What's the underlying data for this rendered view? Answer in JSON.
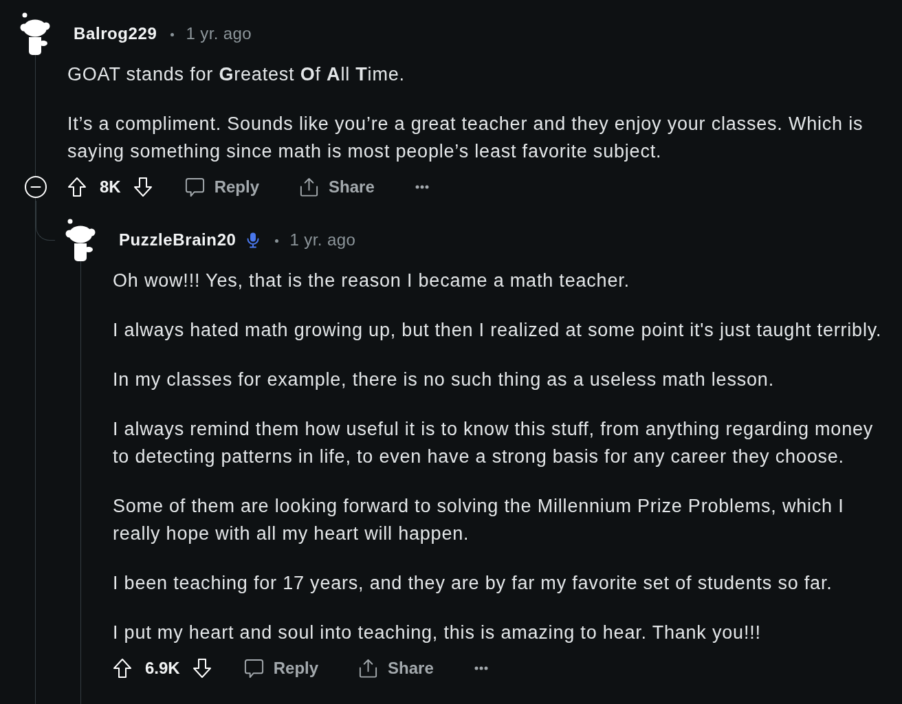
{
  "comments": [
    {
      "author": "Balrog229",
      "time": "1 yr. ago",
      "body": [
        "GOAT stands for **G**reatest **O**f **A**ll **T**ime.",
        "It’s a compliment. Sounds like you’re a great teacher and they enjoy your classes. Which is saying something since math is most people’s least favorite subject."
      ],
      "expanded": true,
      "votes": "8K",
      "reply_label": "Reply",
      "share_label": "Share",
      "replies": [
        {
          "author": "PuzzleBrain20",
          "mic_badge": true,
          "time": "1 yr. ago",
          "body": [
            "Oh wow!!! Yes, that is the reason I became a math teacher.",
            "I always hated math growing up, but then I realized at some point it's just taught terribly.",
            "In my classes for example, there is no such thing as a useless math lesson.",
            "I always remind them how useful it is to know this stuff, from anything regarding money to detecting patterns in life, to even have a strong basis for any career they choose.",
            "Some of them are looking forward to solving the Millennium Prize Problems, which I really hope with all my heart will happen.",
            "I been teaching for 17 years, and they are by far my favorite set of students so far.",
            "I put my heart and soul into teaching, this is amazing to hear. Thank you!!!"
          ],
          "votes": "6.9K",
          "reply_label": "Reply",
          "share_label": "Share"
        }
      ]
    }
  ]
}
